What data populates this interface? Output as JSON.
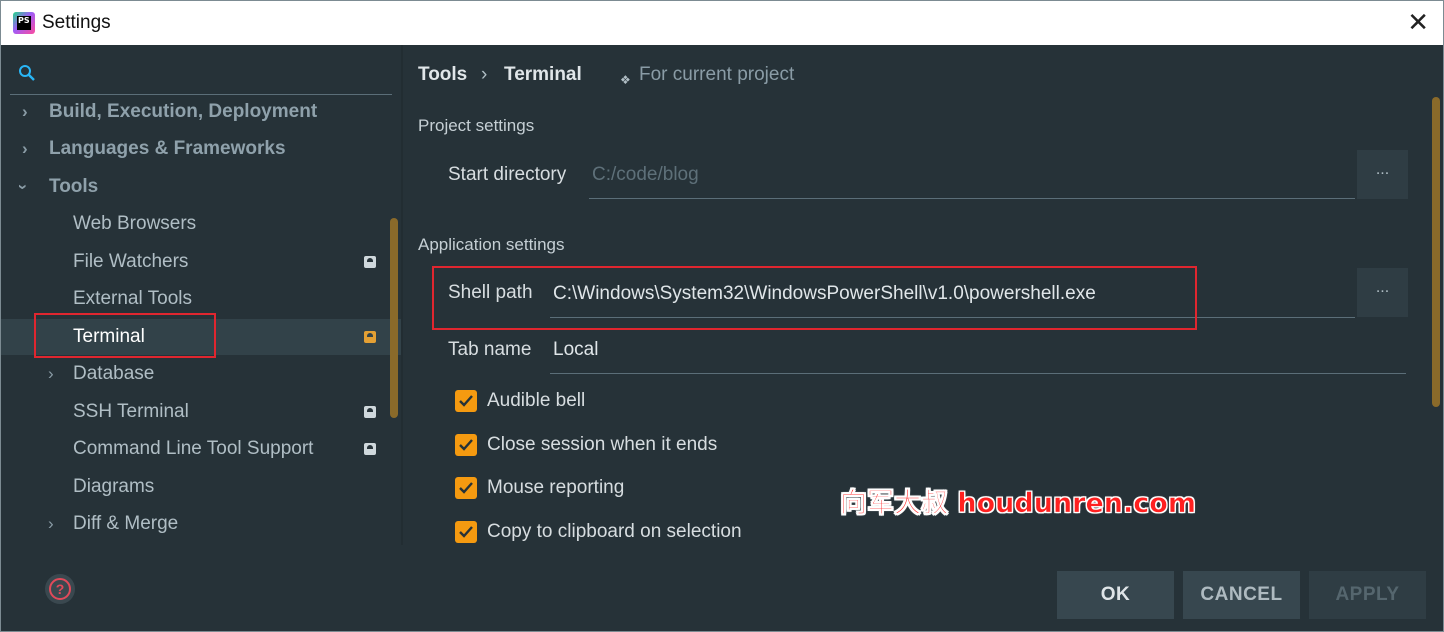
{
  "window": {
    "title": "Settings",
    "app_logo_text": "PS",
    "close_glyph": "✕"
  },
  "sidebar": {
    "search_placeholder": "",
    "items": [
      {
        "label": "Build, Execution, Deployment",
        "level": 0,
        "expandable": true,
        "expanded": false
      },
      {
        "label": "Languages & Frameworks",
        "level": 0,
        "expandable": true,
        "expanded": false
      },
      {
        "label": "Tools",
        "level": 0,
        "expandable": true,
        "expanded": true
      },
      {
        "label": "Web Browsers",
        "level": 1
      },
      {
        "label": "File Watchers",
        "level": 1,
        "project_badge": true
      },
      {
        "label": "External Tools",
        "level": 1
      },
      {
        "label": "Terminal",
        "level": 1,
        "project_badge": true,
        "selected": true
      },
      {
        "label": "Database",
        "level": 1,
        "expandable": true,
        "expanded": false
      },
      {
        "label": "SSH Terminal",
        "level": 1,
        "project_badge": true
      },
      {
        "label": "Command Line Tool Support",
        "level": 1,
        "project_badge": true
      },
      {
        "label": "Diagrams",
        "level": 1
      },
      {
        "label": "Diff & Merge",
        "level": 1,
        "expandable": true,
        "expanded": false
      }
    ]
  },
  "breadcrumb": {
    "parent": "Tools",
    "separator": "›",
    "current": "Terminal",
    "scope_icon": "❖",
    "scope_label": "For current project"
  },
  "project_settings": {
    "heading": "Project settings",
    "start_directory": {
      "label": "Start directory",
      "value": "C:/code/blog",
      "browse": "..."
    }
  },
  "application_settings": {
    "heading": "Application settings",
    "shell_path": {
      "label": "Shell path",
      "value": "C:\\Windows\\System32\\WindowsPowerShell\\v1.0\\powershell.exe",
      "browse": "..."
    },
    "tab_name": {
      "label": "Tab name",
      "value": "Local"
    },
    "checkboxes": [
      {
        "label": "Audible bell",
        "checked": true
      },
      {
        "label": "Close session when it ends",
        "checked": true
      },
      {
        "label": "Mouse reporting",
        "checked": true
      },
      {
        "label": "Copy to clipboard on selection",
        "checked": true
      }
    ]
  },
  "watermark": "向军大叔 houdunren.com",
  "footer": {
    "help_glyph": "?",
    "ok": "OK",
    "cancel": "CANCEL",
    "apply": "APPLY"
  },
  "colors": {
    "background": "#263238",
    "selected_row": "#324249",
    "checkbox": "#f59a10",
    "highlight_box": "#e0262f",
    "badge_selected": "#e4a034"
  }
}
